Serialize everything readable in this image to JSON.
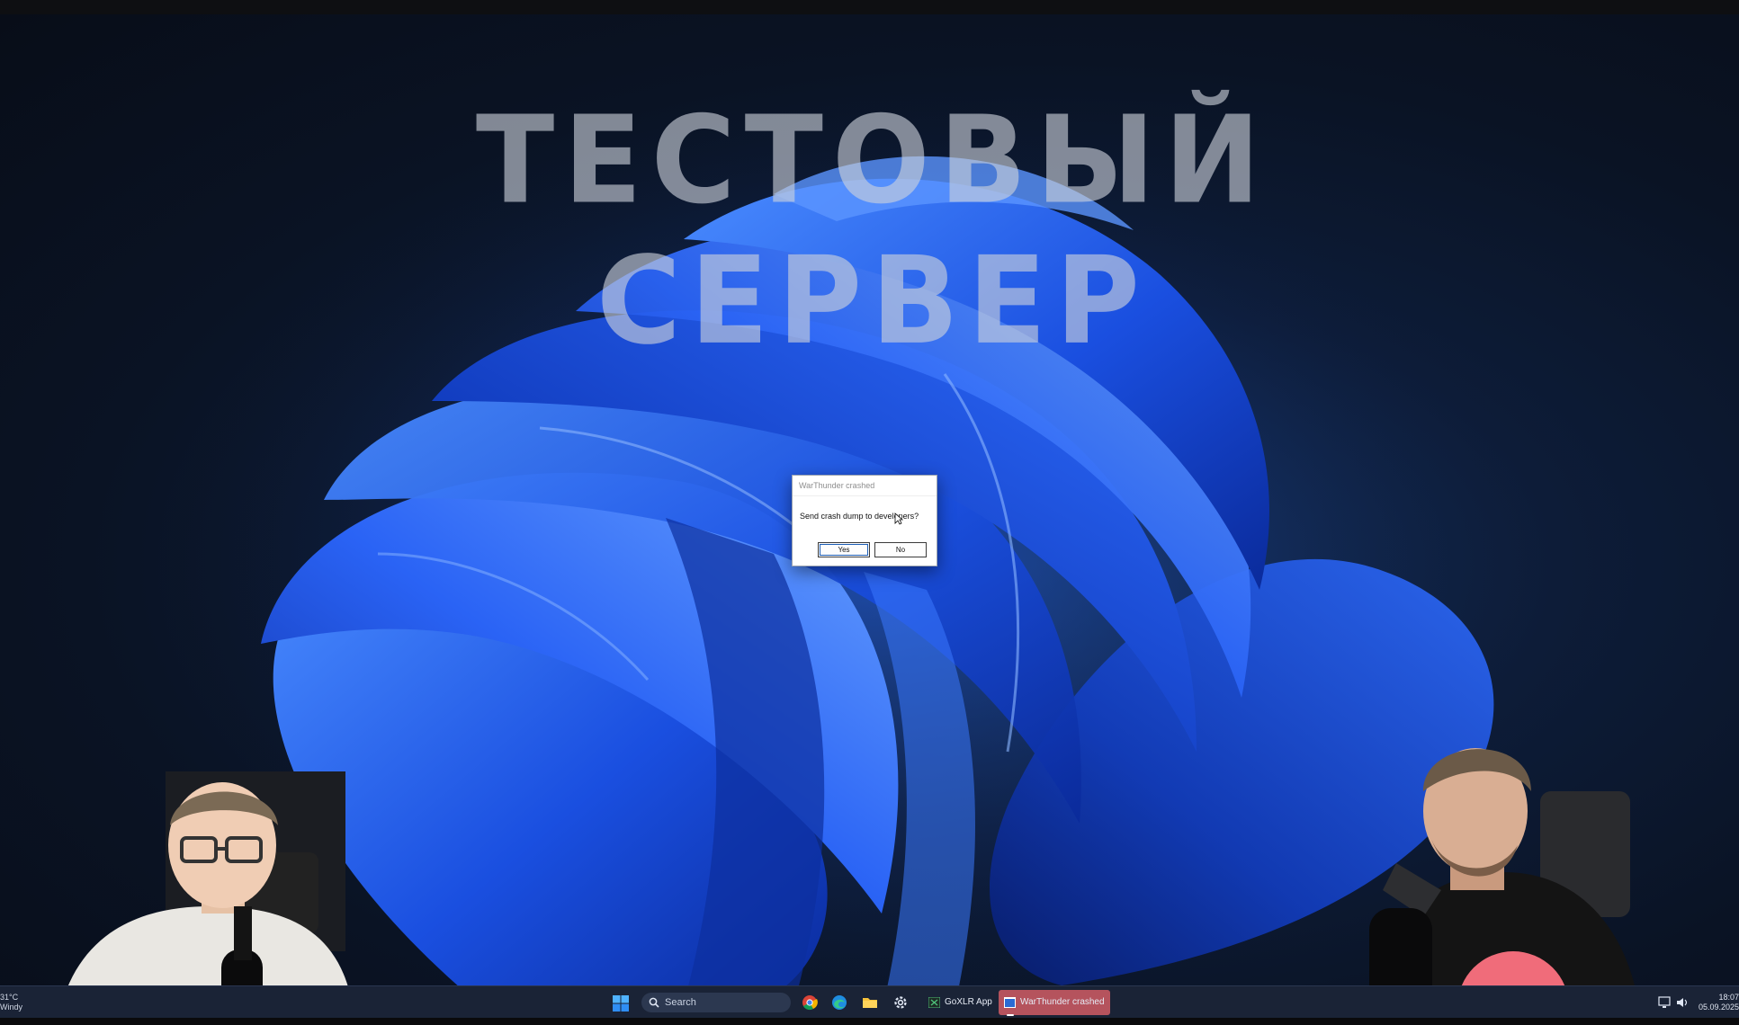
{
  "banner": {
    "text": "ТЕСТОВЫЙ СЕРВЕР"
  },
  "dialog": {
    "title": "WarThunder crashed",
    "message": "Send crash dump to developers?",
    "yes_label": "Yes",
    "no_label": "No"
  },
  "taskbar": {
    "weather_temp": "31°C",
    "weather_desc": "Windy",
    "search_placeholder": "Search",
    "apps": [
      {
        "label": "GoXLR App",
        "icon": "goxlr-icon"
      },
      {
        "label": "WarThunder crashed",
        "icon": "warthunder-icon",
        "active": true
      }
    ],
    "pinned_icons": [
      "chrome-icon",
      "edge-icon",
      "file-explorer-icon",
      "gear-icon"
    ],
    "clock_time": "18:07",
    "clock_date": "05.09.2025"
  },
  "colors": {
    "taskbar_bg": "#1a2336",
    "active_app_bg": "#b5535d",
    "dialog_focus": "#1e5fb6",
    "wallpaper_accent": "#2f6dff"
  }
}
